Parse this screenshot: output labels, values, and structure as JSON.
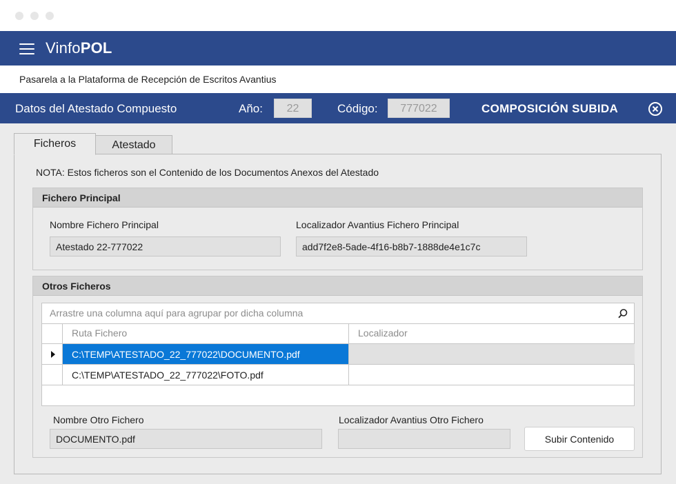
{
  "app": {
    "title_prefix": "Vinfo",
    "title_bold": "POL",
    "subtitle": "Pasarela a la Plataforma de Recepción de Escritos Avantius"
  },
  "header": {
    "title": "Datos del Atestado Compuesto",
    "year_label": "Año:",
    "year_value": "22",
    "code_label": "Código:",
    "code_value": "777022",
    "status": "COMPOSICIÓN SUBIDA",
    "close_icon": "close-circle-icon"
  },
  "tabs": [
    {
      "label": "Ficheros",
      "active": true
    },
    {
      "label": "Atestado",
      "active": false
    }
  ],
  "note": "NOTA: Estos ficheros son el Contenido de los Documentos Anexos del Atestado",
  "main_file": {
    "section_title": "Fichero Principal",
    "name_label": "Nombre Fichero Principal",
    "name_value": "Atestado 22-777022",
    "locator_label": "Localizador Avantius Fichero Principal",
    "locator_value": "add7f2e8-5ade-4f16-b8b7-1888de4e1c7c"
  },
  "other_files": {
    "section_title": "Otros Ficheros",
    "group_placeholder": "Arrastre una columna aquí para agrupar por dicha columna",
    "columns": [
      "Ruta Fichero",
      "Localizador"
    ],
    "rows": [
      {
        "path": "C:\\TEMP\\ATESTADO_22_777022\\DOCUMENTO.pdf",
        "locator": "",
        "selected": true
      },
      {
        "path": "C:\\TEMP\\ATESTADO_22_777022\\FOTO.pdf",
        "locator": "",
        "selected": false
      }
    ],
    "name_label": "Nombre Otro Fichero",
    "name_value": "DOCUMENTO.pdf",
    "locator_label": "Localizador Avantius Otro Fichero",
    "locator_value": "",
    "upload_button": "Subir Contenido"
  },
  "colors": {
    "brand": "#2c4a8c",
    "selection": "#0a78d7"
  }
}
